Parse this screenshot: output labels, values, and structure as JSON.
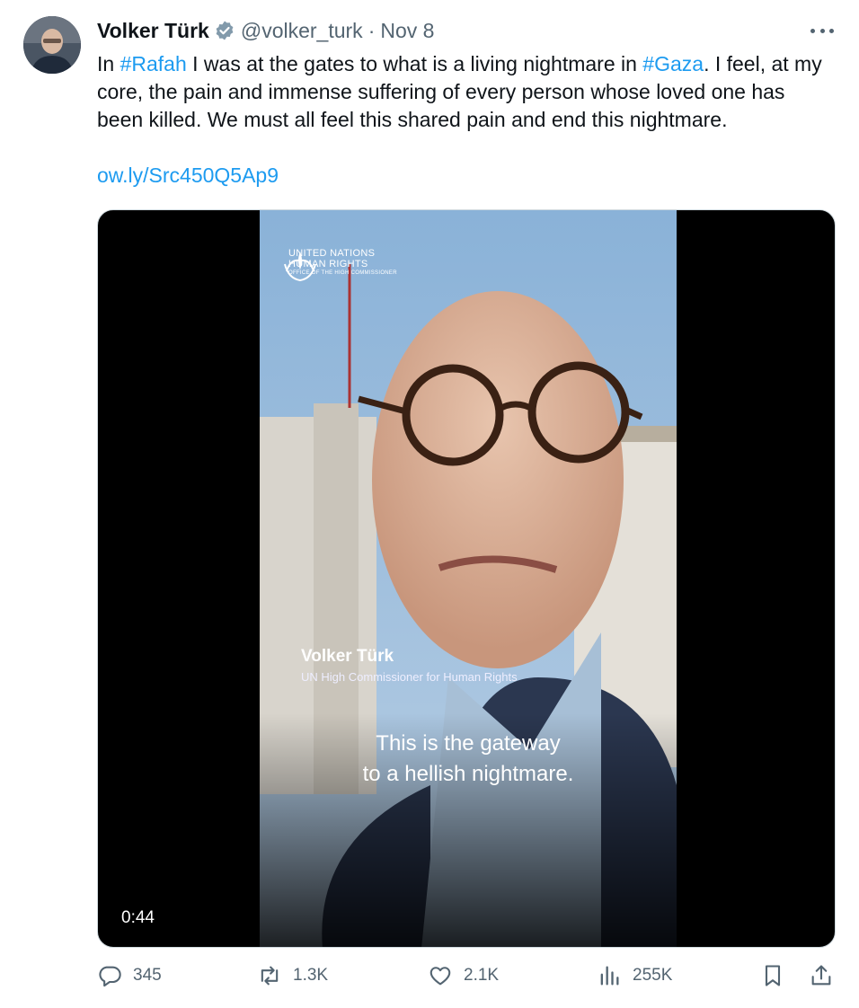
{
  "author": {
    "name": "Volker Türk",
    "handle": "@volker_turk",
    "separator": "·",
    "date": "Nov 8"
  },
  "tweet": {
    "text_parts": [
      "In ",
      "#Rafah",
      " I was at the gates to what is a living nightmare in ",
      "#Gaza",
      ". I feel, at my core, the pain and immense suffering of every person whose loved one has been killed. We must all feel this shared pain and end this nightmare."
    ],
    "link": "ow.ly/Src450Q5Ap9"
  },
  "video": {
    "logo_line1": "UNITED NATIONS",
    "logo_line2": "HUMAN RIGHTS",
    "logo_line3": "OFFICE OF THE HIGH COMMISSIONER",
    "lower_third_name": "Volker Türk",
    "lower_third_title": "UN High Commissioner for Human Rights",
    "caption_line1": "This is the gateway",
    "caption_line2": "to a hellish nightmare.",
    "duration": "0:44"
  },
  "actions": {
    "replies": "345",
    "reposts": "1.3K",
    "likes": "2.1K",
    "views": "255K"
  },
  "colors": {
    "accent": "#1d9bf0",
    "secondary_text": "#536471",
    "primary_text": "#0f1419"
  }
}
